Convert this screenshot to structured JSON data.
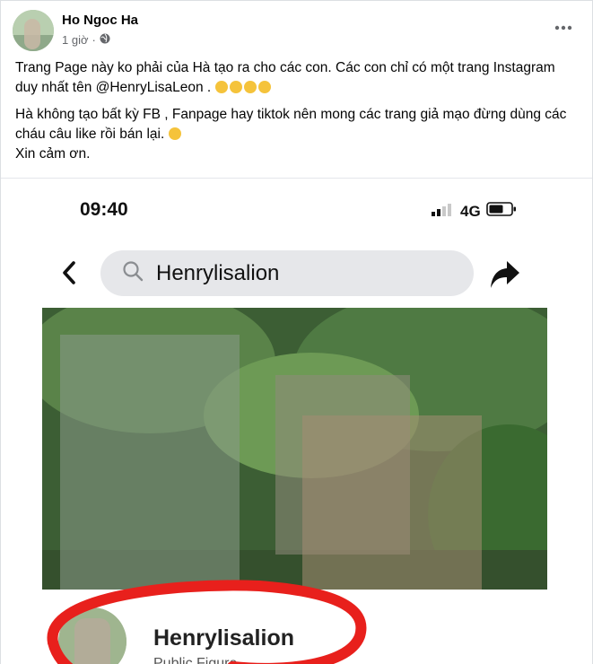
{
  "post": {
    "author": "Ho Ngoc Ha",
    "time": "1 giờ",
    "time_sep": "·",
    "privacy_icon": "globe-icon",
    "more_icon": "more-icon",
    "paragraphs": {
      "p1": "Trang Page này ko phải của Hà tạo ra cho các con. Các con chỉ có một trang Instagram duy nhất tên @HenryLisaLeon .",
      "p2a": "Hà không tạo bất kỳ FB , Fanpage hay tiktok nên mong các trang giả mạo đừng dùng các cháu câu like rồi bán lại.",
      "p2b": "Xin cảm ơn."
    }
  },
  "screenshot": {
    "time": "09:40",
    "network": "4G",
    "search_value": "Henrylisalion",
    "profile_name": "Henrylisalion",
    "profile_subtitle": "Public Figure",
    "colors": {
      "annotation": "#e8201c",
      "search_bg": "#e6e7ea"
    }
  }
}
